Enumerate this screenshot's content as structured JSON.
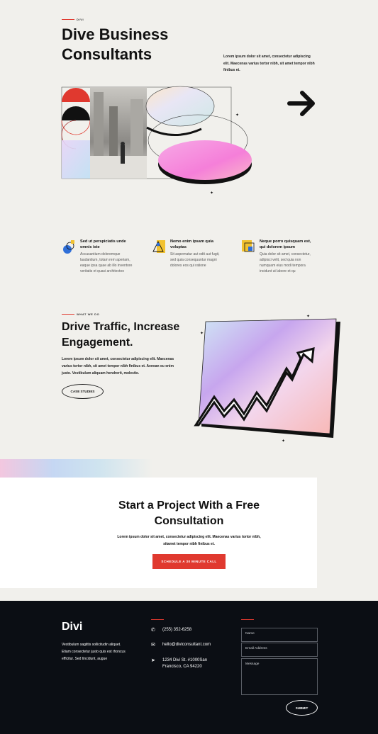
{
  "hero": {
    "eyebrow": "DIVI",
    "title_line1": "Dive Business",
    "title_line2": "Consultants",
    "text_line1": "Lorem ipsum dolor sit amet, consectetur adipiscing",
    "text_line2": "elit. Maecenas varius tortor nibh, sit amet tempor nibh",
    "text_line3": "finibus et."
  },
  "features": [
    {
      "title_line1": "Sed ut perspiciatis unde",
      "title_line2": "omnis iste",
      "text": [
        "Accusantium doloremque",
        "laudantium, totam rem aperiam,",
        "eaque ipsa quae ab illo inventore",
        "veritatis et quasi architectoo"
      ]
    },
    {
      "title_line1": "Nemo enim ipsam quia",
      "title_line2": "voluptas",
      "text": [
        "Sit aspernatur aut odit aut fugit,",
        "sed quia consequuntur magni",
        "dolores eos qui ratione"
      ]
    },
    {
      "title_line1": "Neque porro quisquam est,",
      "title_line2": "qui dolorem ipsum",
      "text": [
        "Quia dolor sit amet, consectetur,",
        "adipisci velit, sed quia non",
        "numquam eius modi tempora",
        "incidunt ut labore et qu"
      ]
    }
  ],
  "traffic": {
    "eyebrow": "WHAT WE DO",
    "title_line1": "Drive Traffic, Increase",
    "title_line2": "Engagement.",
    "text_line1": "Lorem ipsum dolor sit amet, consectetur adipiscing elit. Maecenas",
    "text_line2": "varius tortor nibh, sit amet tempor nibh finibus et. Aenean eu enim",
    "text_line3": "justo. Vestibulum aliquam hendrerit, molestie.",
    "button": "CASE STUDIES"
  },
  "cta": {
    "title_line1": "Start a Project With a Free",
    "title_line2": "Consultation",
    "text_line1": "Lorem ipsum dolor sit amet, consectetur adipiscing elit. Maecenas varius tortor nibh,",
    "text_line2": "sitamet tempor nibh finibus et.",
    "button": "SCHEDULE A 30 MINUTE CALL"
  },
  "footer": {
    "logo": "Divi",
    "about_line1": "Vestibulum sagittis sollicitudin aliquet.",
    "about_line2": "Etiam consectetur justo quis est rhoncus",
    "about_line3": "efficitur. Sed tincidunt, augue",
    "phone": "(255) 352-6258",
    "email": "hello@diviconsultant.com",
    "address_line1": "1234 Divi St. #1000San",
    "address_line2": "Francisco, CA 94220",
    "form": {
      "name_placeholder": "Name",
      "email_placeholder": "Email Address",
      "message_placeholder": "Message",
      "submit": "SUBMIT"
    }
  },
  "colors": {
    "background": "#f1f0ec",
    "accent_red": "#e0392f",
    "footer_bg": "#0b0e14"
  }
}
